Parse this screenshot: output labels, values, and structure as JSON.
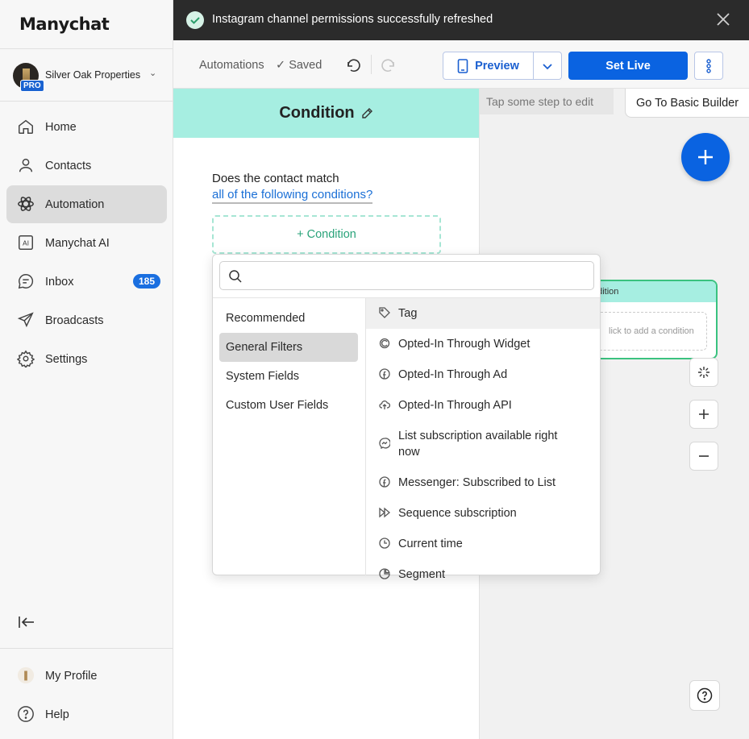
{
  "brand": {
    "logo": "Manychat"
  },
  "account": {
    "name": "Silver Oak Properties",
    "badge": "PRO"
  },
  "nav": {
    "items": [
      {
        "label": "Home",
        "icon": "home-icon"
      },
      {
        "label": "Contacts",
        "icon": "person-icon"
      },
      {
        "label": "Automation",
        "icon": "atom-icon",
        "active": true
      },
      {
        "label": "Manychat AI",
        "icon": "ai-icon"
      },
      {
        "label": "Inbox",
        "icon": "chat-icon",
        "badge": "185"
      },
      {
        "label": "Broadcasts",
        "icon": "send-icon"
      },
      {
        "label": "Settings",
        "icon": "gear-icon"
      }
    ],
    "bottom": [
      {
        "label": "My Profile",
        "icon": "profile-icon"
      },
      {
        "label": "Help",
        "icon": "help-icon"
      }
    ]
  },
  "toast": {
    "message": "Instagram channel permissions successfully refreshed"
  },
  "toolbar": {
    "breadcrumb": "Automations",
    "saved": "Saved",
    "preview": "Preview",
    "set_live": "Set Live"
  },
  "canvas": {
    "hint": "Tap some step to edit",
    "basic_builder": "Go To Basic Builder",
    "node_title": "ndition",
    "node_placeholder": "lick to add a condition"
  },
  "panel": {
    "title": "Condition",
    "question_line1": "Does the contact match",
    "question_line2": "all of the following conditions?",
    "add_condition": "+ Condition"
  },
  "dropdown": {
    "search_placeholder": "",
    "categories": [
      "Recommended",
      "General Filters",
      "System Fields",
      "Custom User Fields"
    ],
    "active_category": "General Filters",
    "options": [
      {
        "label": "Tag",
        "icon": "tag-icon"
      },
      {
        "label": "Opted-In Through Widget",
        "icon": "widget-icon"
      },
      {
        "label": "Opted-In Through Ad",
        "icon": "facebook-icon"
      },
      {
        "label": "Opted-In Through API",
        "icon": "cloud-upload-icon"
      },
      {
        "label": "List subscription available right now",
        "icon": "messenger-icon"
      },
      {
        "label": "Messenger: Subscribed to List",
        "icon": "facebook-icon"
      },
      {
        "label": "Sequence subscription",
        "icon": "sequence-icon"
      },
      {
        "label": "Current time",
        "icon": "clock-icon"
      },
      {
        "label": "Segment",
        "icon": "pie-icon"
      }
    ]
  },
  "colors": {
    "accent": "#0a63e1",
    "header_mint": "#a6eee1",
    "success": "#3ac27f"
  }
}
